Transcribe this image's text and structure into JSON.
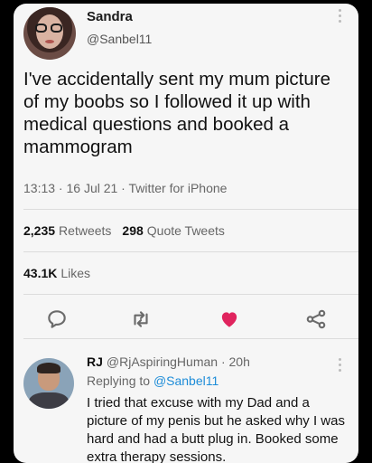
{
  "tweet": {
    "author_name": "Sandra",
    "author_handle": "@Sanbel11",
    "text": "I've accidentally sent my mum picture of my boobs so I followed it up with medical questions and booked a mammogram",
    "meta": "13:13 · 16 Jul 21 · Twitter for iPhone",
    "retweets_count": "2,235",
    "retweets_label": "Retweets",
    "quote_count": "298",
    "quote_label": "Quote Tweets",
    "likes_count": "43.1K",
    "likes_label": "Likes"
  },
  "actions": {
    "icons": [
      "reply-icon",
      "retweet-icon",
      "like-icon",
      "share-icon"
    ],
    "like_color": "#e0245e",
    "icon_color": "#6b6b6b"
  },
  "reply": {
    "author_name": "RJ",
    "author_handle": "@RjAspiringHuman",
    "time": "· 20h",
    "replying_prefix": "Replying to",
    "replying_handle": "@Sanbel11",
    "text": "I tried that excuse with my Dad and a picture of my penis but he asked why I was hard and had a butt plug in. Booked some extra therapy sessions."
  },
  "colors": {
    "link": "#1d8cd8",
    "card_bg": "#f6f6f6",
    "page_bg": "#000000"
  }
}
